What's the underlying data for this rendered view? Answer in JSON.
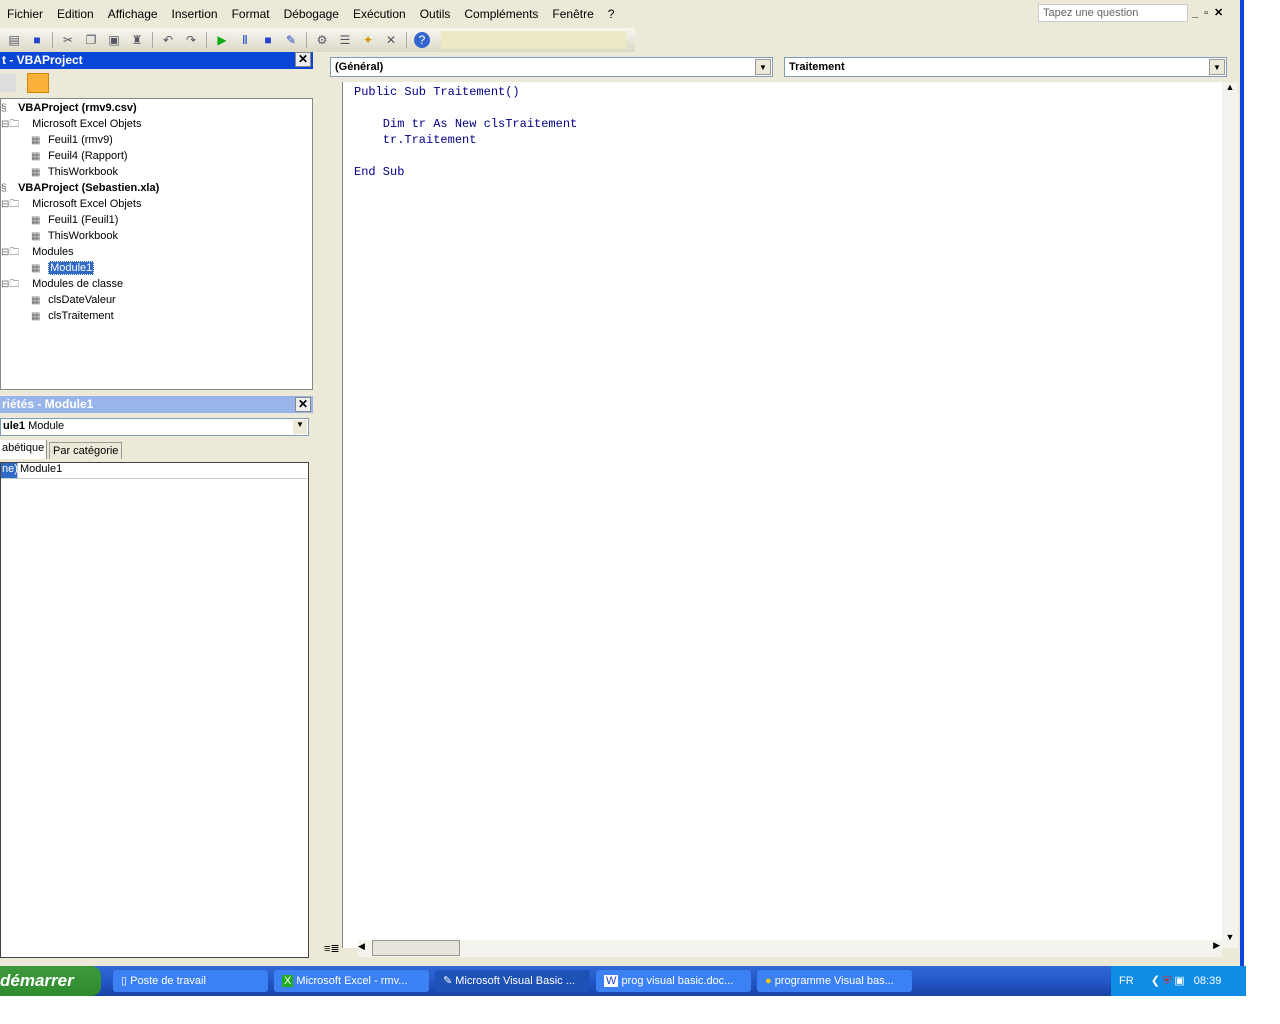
{
  "menu": [
    "Fichier",
    "Edition",
    "Affichage",
    "Insertion",
    "Format",
    "Débogage",
    "Exécution",
    "Outils",
    "Compléments",
    "Fenêtre",
    "?"
  ],
  "ask_placeholder": "Tapez une question",
  "project": {
    "title": "t - VBAProject",
    "nodes": [
      {
        "label": "VBAProject (rmv9.csv)",
        "bold": true,
        "level": 0
      },
      {
        "label": "Microsoft Excel Objets",
        "level": 1
      },
      {
        "label": "Feuil1 (rmv9)",
        "level": 2
      },
      {
        "label": "Feuil4 (Rapport)",
        "level": 2
      },
      {
        "label": "ThisWorkbook",
        "level": 2
      },
      {
        "label": "VBAProject (Sebastien.xla)",
        "bold": true,
        "level": 0
      },
      {
        "label": "Microsoft Excel Objets",
        "level": 1
      },
      {
        "label": "Feuil1 (Feuil1)",
        "level": 2
      },
      {
        "label": "ThisWorkbook",
        "level": 2
      },
      {
        "label": "Modules",
        "level": 1
      },
      {
        "label": "Module1",
        "level": 2,
        "selected": true
      },
      {
        "label": "Modules de classe",
        "level": 1
      },
      {
        "label": "clsDateValeur",
        "level": 2
      },
      {
        "label": "clsTraitement",
        "level": 2
      }
    ]
  },
  "properties": {
    "title": "riétés - Module1",
    "object_name": "ule1",
    "object_type": "Module",
    "tab_alpha": "abétique",
    "tab_category": "Par catégorie",
    "prop_name": "ne)",
    "prop_value": "Module1"
  },
  "code": {
    "object_combo": "(Général)",
    "proc_combo": "Traitement",
    "lines": [
      "Public Sub Traitement()",
      "",
      "    Dim tr As New clsTraitement",
      "    tr.Traitement",
      "",
      "End Sub"
    ]
  },
  "taskbar": {
    "start": "démarrer",
    "tasks": [
      "Poste de travail",
      "Microsoft Excel - rmv...",
      "Microsoft Visual Basic ...",
      "prog visual basic.doc...",
      "programme Visual bas..."
    ],
    "active": 2,
    "lang": "FR",
    "time": "08:39"
  }
}
